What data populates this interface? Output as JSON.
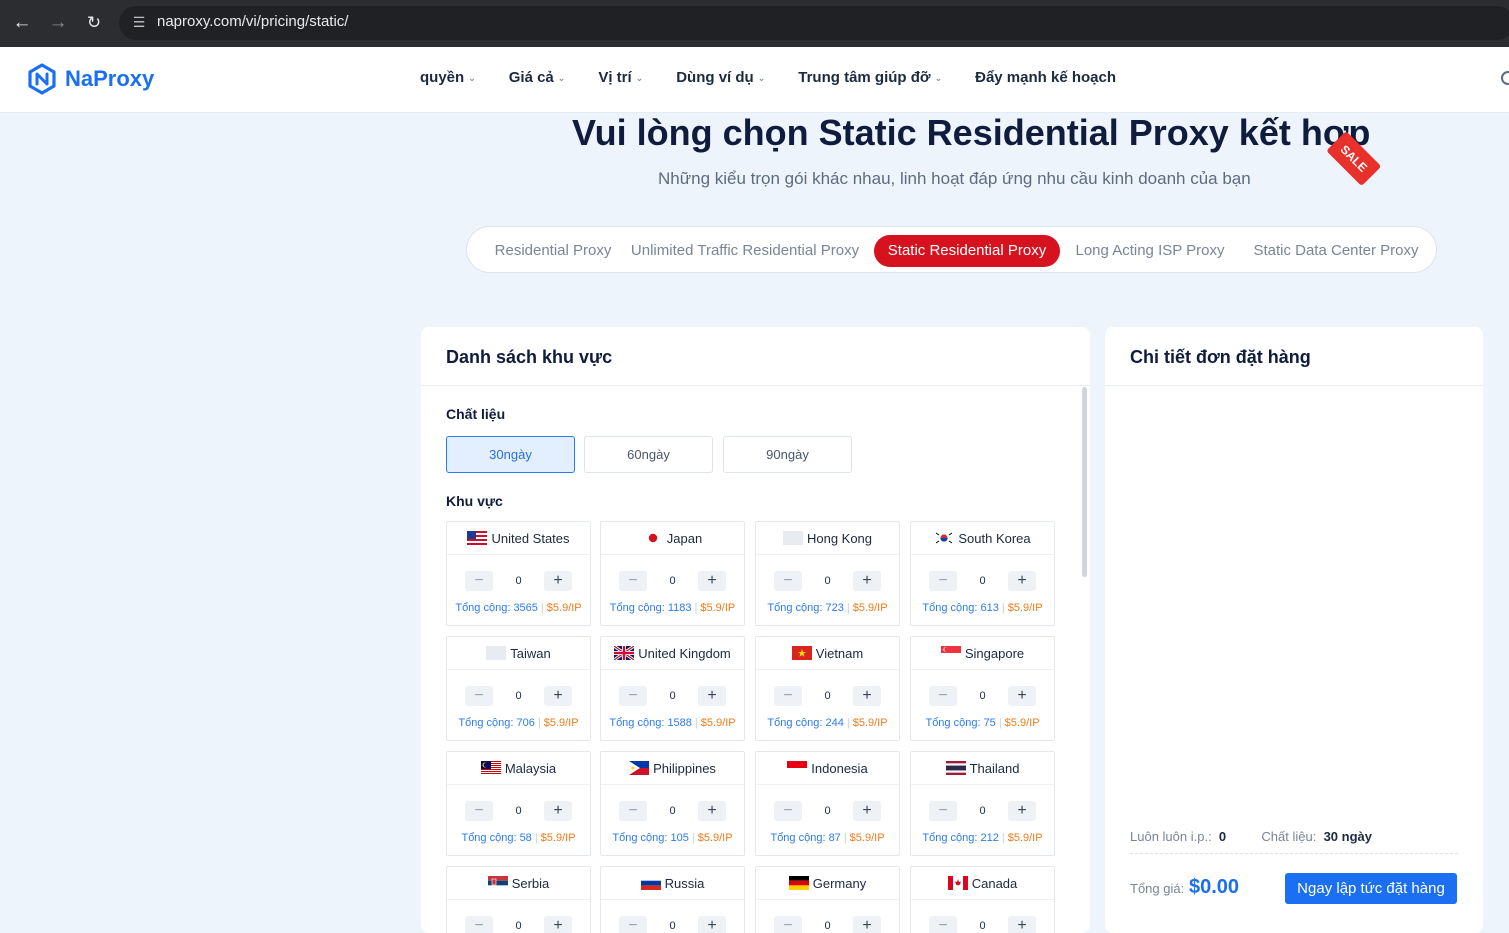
{
  "browser": {
    "url": "naproxy.com/vi/pricing/static/",
    "back_icon": "arrow-left-icon",
    "forward_icon": "arrow-right-icon",
    "reload_icon": "reload-icon",
    "site_settings_icon": "tune-icon"
  },
  "header": {
    "logo_text": "NaProxy",
    "brand_color": "#1a6ff2",
    "nav": [
      {
        "label": "quyền",
        "has_dropdown": true
      },
      {
        "label": "Giá cả",
        "has_dropdown": true
      },
      {
        "label": "Vị trí",
        "has_dropdown": true
      },
      {
        "label": "Dùng ví dụ",
        "has_dropdown": true
      },
      {
        "label": "Trung tâm giúp đỡ",
        "has_dropdown": true
      },
      {
        "label": "Đẩy mạnh kế hoạch",
        "has_dropdown": false
      }
    ]
  },
  "hero": {
    "title": "Vui lòng chọn Static Residential Proxy kết hợp",
    "sale_badge": "SALE",
    "subtitle": "Những kiểu trọn gói khác nhau, linh hoạt đáp ứng nhu cầu kinh doanh của bạn",
    "accent_color": "#d7121f"
  },
  "tabs": [
    {
      "label": "Residential Proxy",
      "active": false
    },
    {
      "label": "Unlimited Traffic Residential Proxy",
      "active": false
    },
    {
      "label": "Static Residential Proxy",
      "active": true
    },
    {
      "label": "Long Acting ISP Proxy",
      "active": false
    },
    {
      "label": "Static Data Center Proxy",
      "active": false
    }
  ],
  "region_panel": {
    "title": "Danh sách khu vực",
    "material_label": "Chất liệu",
    "durations": [
      {
        "label": "30ngày",
        "selected": true
      },
      {
        "label": "60ngày",
        "selected": false
      },
      {
        "label": "90ngày",
        "selected": false
      }
    ],
    "region_label": "Khu vực",
    "countries": [
      {
        "name": "United States",
        "flag": "us",
        "qty": "0",
        "total": "Tổng cộng: 3565",
        "price": "$5.9/IP"
      },
      {
        "name": "Japan",
        "flag": "jp",
        "qty": "0",
        "total": "Tổng cộng: 1183",
        "price": "$5.9/IP"
      },
      {
        "name": "Hong Kong",
        "flag": "hk",
        "qty": "0",
        "total": "Tổng cộng: 723",
        "price": "$5.9/IP"
      },
      {
        "name": "South Korea",
        "flag": "kr",
        "qty": "0",
        "total": "Tổng cộng: 613",
        "price": "$5.9/IP"
      },
      {
        "name": "Taiwan",
        "flag": "tw",
        "qty": "0",
        "total": "Tổng cộng: 706",
        "price": "$5.9/IP"
      },
      {
        "name": "United Kingdom",
        "flag": "gb",
        "qty": "0",
        "total": "Tổng cộng: 1588",
        "price": "$5.9/IP"
      },
      {
        "name": "Vietnam",
        "flag": "vn",
        "qty": "0",
        "total": "Tổng cộng: 244",
        "price": "$5.9/IP"
      },
      {
        "name": "Singapore",
        "flag": "sg",
        "qty": "0",
        "total": "Tổng cộng: 75",
        "price": "$5.9/IP"
      },
      {
        "name": "Malaysia",
        "flag": "my",
        "qty": "0",
        "total": "Tổng cộng: 58",
        "price": "$5.9/IP"
      },
      {
        "name": "Philippines",
        "flag": "ph",
        "qty": "0",
        "total": "Tổng cộng: 105",
        "price": "$5.9/IP"
      },
      {
        "name": "Indonesia",
        "flag": "id",
        "qty": "0",
        "total": "Tổng cộng: 87",
        "price": "$5.9/IP"
      },
      {
        "name": "Thailand",
        "flag": "th",
        "qty": "0",
        "total": "Tổng cộng: 212",
        "price": "$5.9/IP"
      },
      {
        "name": "Serbia",
        "flag": "rs",
        "qty": "0",
        "total": "",
        "price": ""
      },
      {
        "name": "Russia",
        "flag": "ru",
        "qty": "0",
        "total": "",
        "price": ""
      },
      {
        "name": "Germany",
        "flag": "de",
        "qty": "0",
        "total": "",
        "price": ""
      },
      {
        "name": "Canada",
        "flag": "ca",
        "qty": "0",
        "total": "",
        "price": ""
      }
    ]
  },
  "order_panel": {
    "title": "Chi tiết đơn đặt hàng",
    "ip_label": "Luôn luôn i.p.:",
    "ip_value": "0",
    "material_label": "Chất liệu:",
    "material_value": "30",
    "material_unit": "ngày",
    "total_label": "Tổng giá:",
    "total_value": "$0.00",
    "order_button": "Ngay lập tức đặt hàng"
  }
}
